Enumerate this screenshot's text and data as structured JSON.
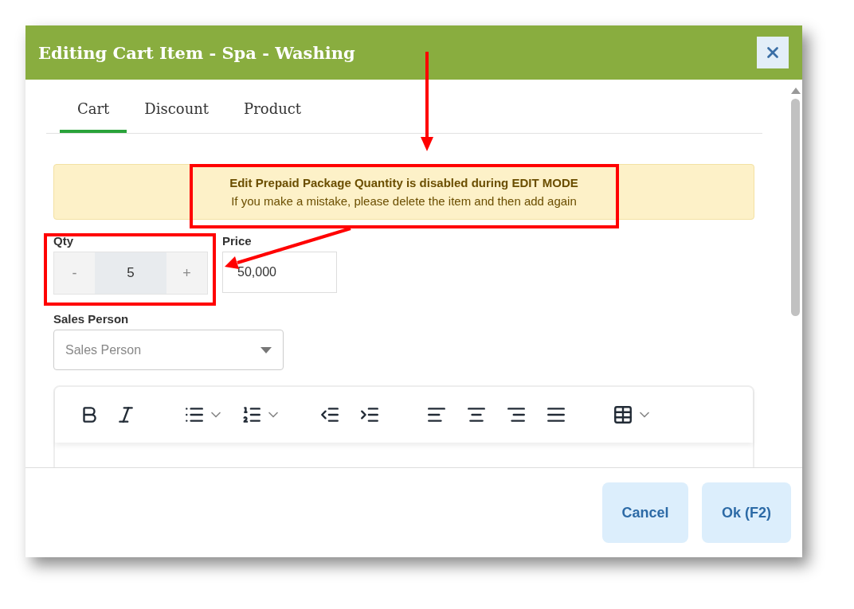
{
  "dialog": {
    "title": "Editing Cart Item - Spa - Washing"
  },
  "tabs": [
    {
      "label": "Cart",
      "selected": true
    },
    {
      "label": "Discount",
      "selected": false
    },
    {
      "label": "Product",
      "selected": false
    }
  ],
  "notice": {
    "heading": "Edit Prepaid Package Quantity is disabled during EDIT MODE",
    "message": "If you make a mistake, please delete the item and then add again"
  },
  "qty": {
    "label": "Qty",
    "decrement": "-",
    "value": "5",
    "increment": "+",
    "disabled": true
  },
  "price": {
    "label": "Price",
    "value": "50,000"
  },
  "sales_person": {
    "label": "Sales Person",
    "placeholder": "Sales Person"
  },
  "buttons": [
    {
      "label": "Cancel"
    },
    {
      "label": "Ok (F2)"
    }
  ]
}
